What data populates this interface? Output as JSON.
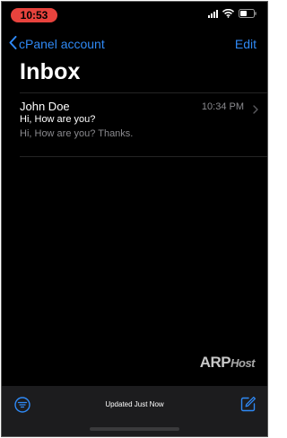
{
  "status_bar": {
    "time": "10:53"
  },
  "nav": {
    "back_label": "cPanel account",
    "edit_label": "Edit"
  },
  "title": "Inbox",
  "messages": [
    {
      "sender": "John Doe",
      "time": "10:34 PM",
      "subject": "Hi, How are you?",
      "preview": "Hi, How are you? Thanks."
    }
  ],
  "watermark": {
    "brand": "ARP",
    "suffix": "Host"
  },
  "toolbar": {
    "status": "Updated Just Now"
  },
  "colors": {
    "accent": "#2f89f5",
    "time_pill": "#e8433d",
    "background": "#000000",
    "toolbar": "#1c1c1e",
    "secondary_text": "#8a8a8e"
  },
  "icons": {
    "back": "chevron-left-icon",
    "row": "chevron-right-icon",
    "filter": "filter-icon",
    "compose": "compose-icon",
    "signal": "signal-icon",
    "wifi": "wifi-icon",
    "battery": "battery-icon"
  }
}
